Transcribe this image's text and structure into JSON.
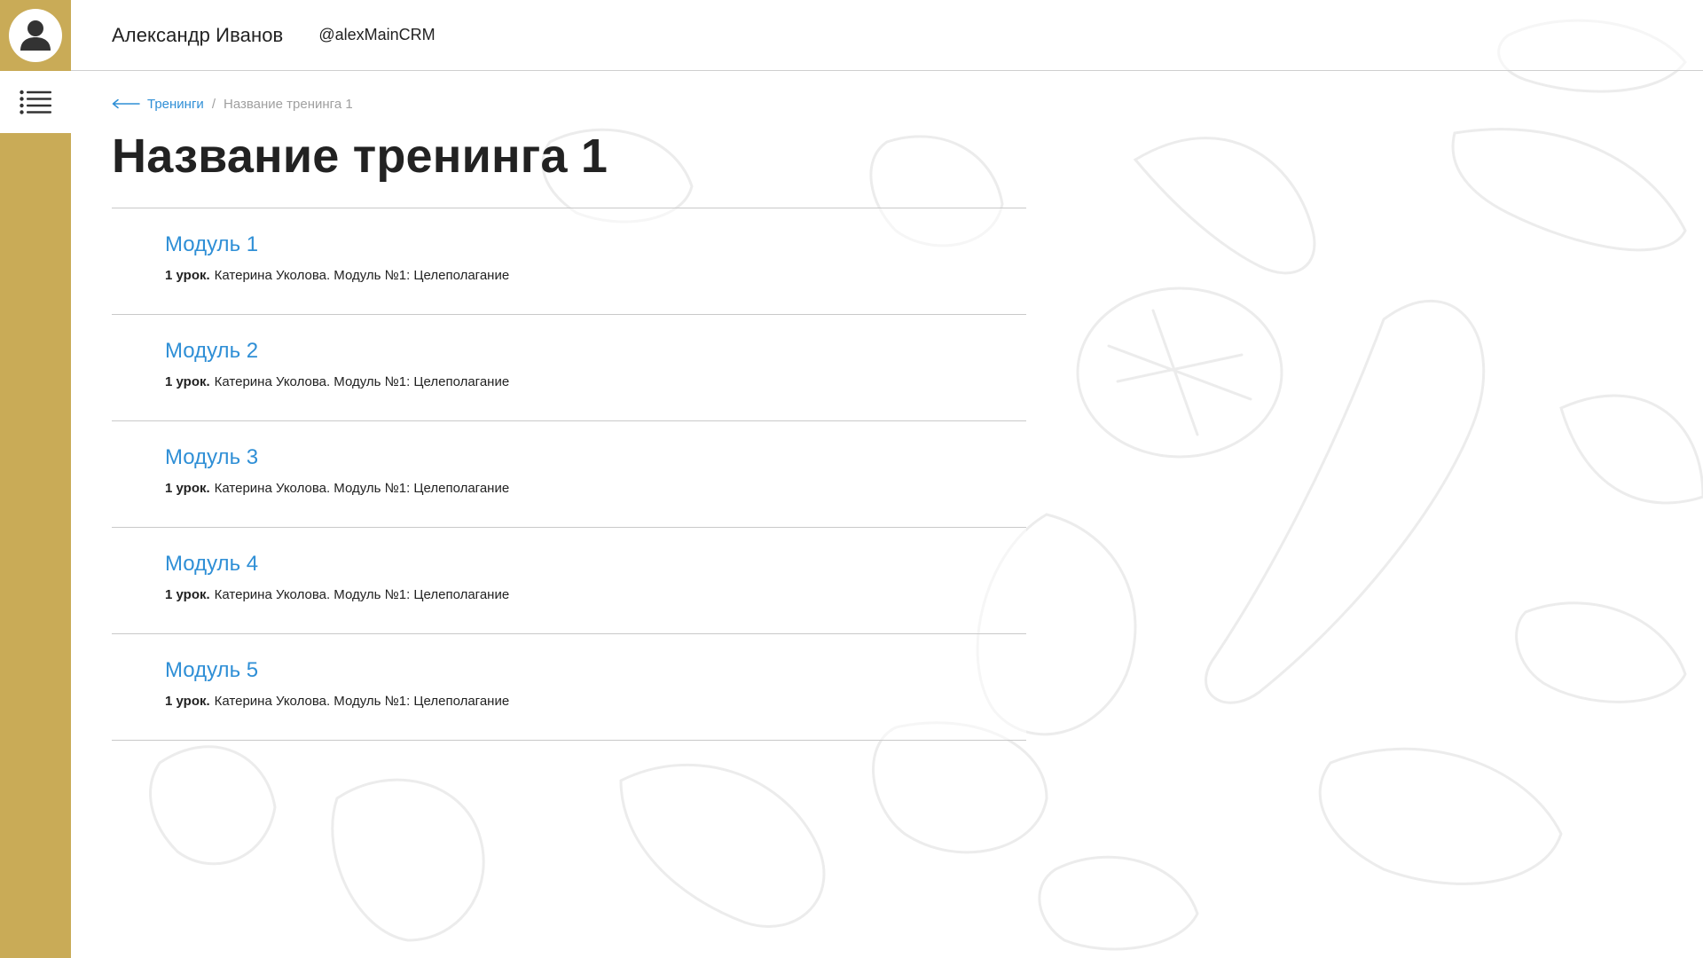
{
  "header": {
    "user_name": "Александр Иванов",
    "user_handle": "@alexMainCRM"
  },
  "sidebar": {
    "avatar_icon": "user-icon",
    "menu_icon": "list-icon",
    "accent_color": "#c9ab57"
  },
  "breadcrumb": {
    "back_icon": "arrow-left-icon",
    "back_label": "Тренинги",
    "separator": "/",
    "current": "Название тренинга 1"
  },
  "page": {
    "title": "Название тренинга 1"
  },
  "modules": [
    {
      "title": "Модуль 1",
      "lesson_count": "1 урок.",
      "lesson_text": "Катерина Уколова. Модуль №1: Целеполагание"
    },
    {
      "title": "Модуль 2",
      "lesson_count": "1 урок.",
      "lesson_text": "Катерина Уколова. Модуль №1: Целеполагание"
    },
    {
      "title": "Модуль 3",
      "lesson_count": "1 урок.",
      "lesson_text": "Катерина Уколова. Модуль №1: Целеполагание"
    },
    {
      "title": "Модуль 4",
      "lesson_count": "1 урок.",
      "lesson_text": "Катерина Уколова. Модуль №1: Целеполагание"
    },
    {
      "title": "Модуль 5",
      "lesson_count": "1 урок.",
      "lesson_text": "Катерина Уколова. Модуль №1: Целеполагание"
    }
  ],
  "colors": {
    "link": "#2f8fd6",
    "muted": "#a0a0a0",
    "divider": "#c9c9c9",
    "text": "#222222"
  }
}
